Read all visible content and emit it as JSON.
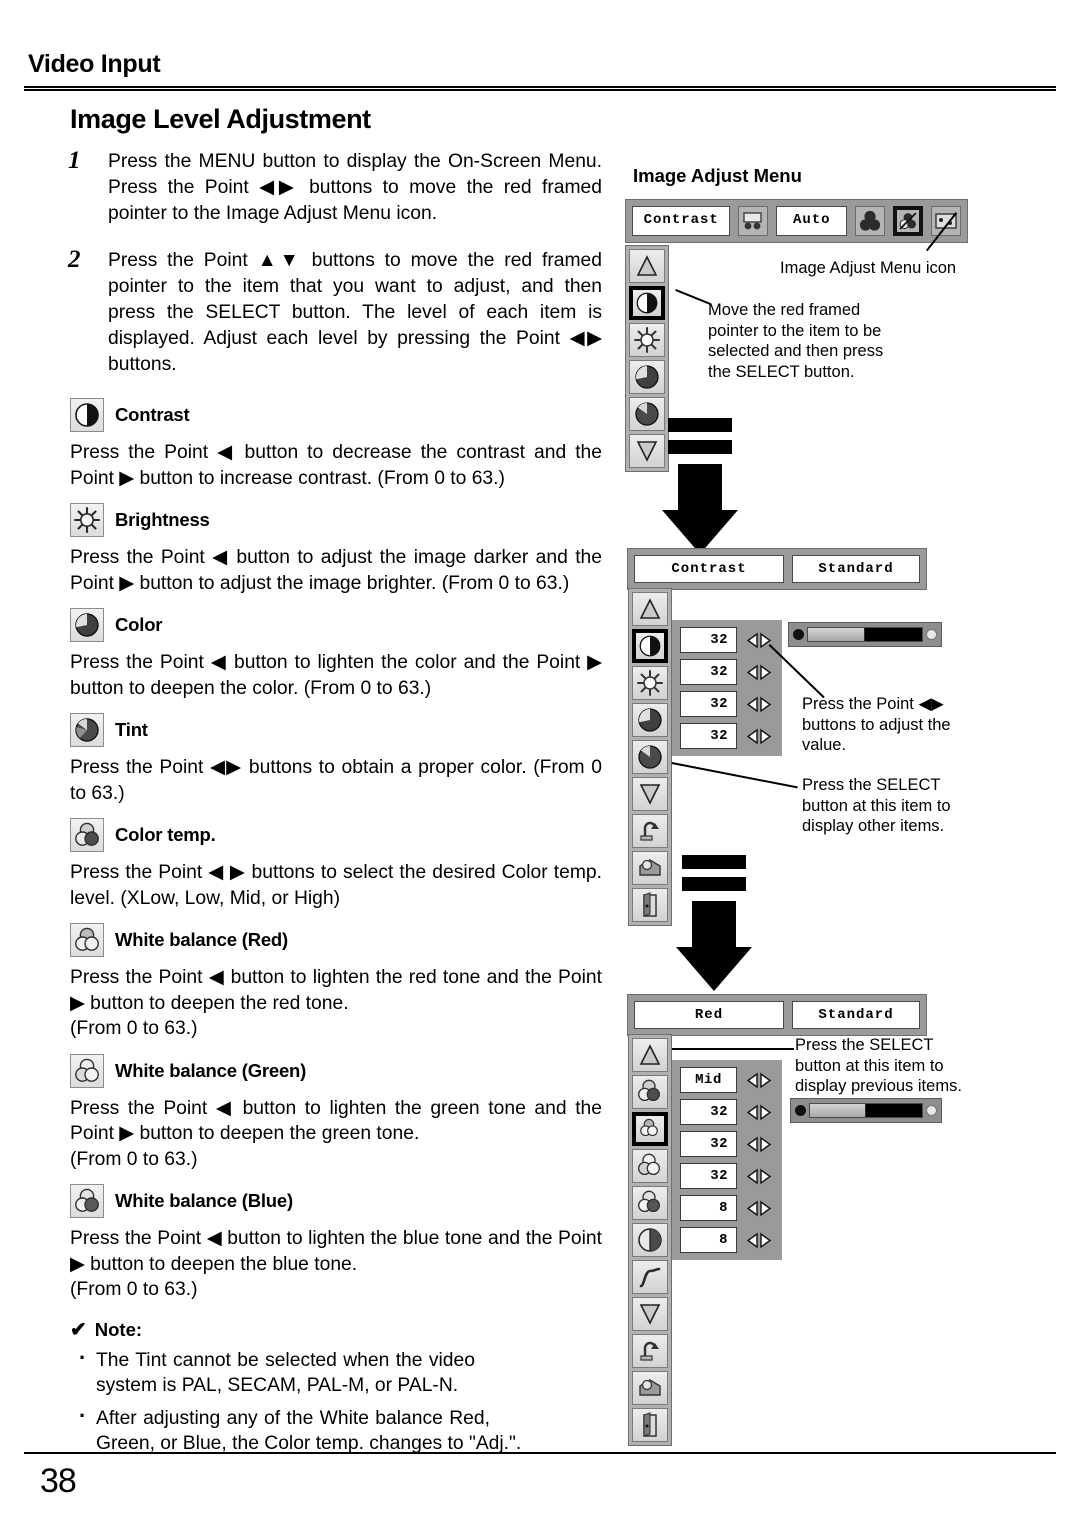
{
  "header": {
    "title": "Video Input"
  },
  "main": {
    "heading": "Image Level Adjustment",
    "steps": [
      {
        "num": "1",
        "text": "Press the MENU button to display the On-Screen Menu.  Press the Point ◀▶ buttons to move the red framed pointer to the Image Adjust Menu icon."
      },
      {
        "num": "2",
        "text": "Press the Point ▲▼ buttons to move the red framed pointer to the item that you want to adjust, and then press the SELECT button.  The level of each item is displayed.  Adjust each level by pressing the Point ◀▶ buttons."
      }
    ],
    "items": [
      {
        "icon": "contrast-icon",
        "title": "Contrast",
        "body": "Press the Point ◀ button to decrease the contrast and the Point ▶ button to increase contrast. (From 0 to 63.)"
      },
      {
        "icon": "brightness-icon",
        "title": "Brightness",
        "body": "Press the Point ◀ button to adjust the image darker and the Point ▶ button to adjust the image brighter. (From 0 to 63.)"
      },
      {
        "icon": "color-icon",
        "title": "Color",
        "body": "Press the Point ◀ button to lighten the color and the Point ▶ button to deepen the color. (From 0 to 63.)"
      },
      {
        "icon": "tint-icon",
        "title": "Tint",
        "body": "Press the Point ◀▶ buttons to obtain a proper color. (From 0 to 63.)"
      },
      {
        "icon": "color-temp-icon",
        "title": "Color temp.",
        "body": "Press the Point ◀ ▶ buttons to select the desired Color temp. level.  (XLow, Low, Mid, or High)"
      },
      {
        "icon": "white-balance-red-icon",
        "title": "White balance (Red)",
        "body": "Press the Point ◀ button to lighten the red tone and the Point ▶ button to deepen the red tone.\n(From 0 to 63.)"
      },
      {
        "icon": "white-balance-green-icon",
        "title": "White balance (Green)",
        "body": "Press the Point ◀ button to lighten the green tone and the Point ▶ button to deepen the green tone.\n(From 0 to 63.)"
      },
      {
        "icon": "white-balance-blue-icon",
        "title": "White balance (Blue)",
        "body": "Press the Point ◀ button to lighten the blue tone and the Point ▶ button to deepen the blue tone.\n(From 0 to 63.)"
      }
    ],
    "note": {
      "check": "✔",
      "label": "Note:",
      "bullets": [
        {
          "l1": "The Tint cannot be selected when the video",
          "l2": "system is PAL, SECAM, PAL-M, or PAL-N."
        },
        {
          "l1": "After adjusting any of the White balance Red,",
          "l2": "Green, or Blue, the Color temp. changes to \"Adj.\"."
        }
      ]
    }
  },
  "sidebar_figure": {
    "title": "Image Adjust Menu",
    "menubar": {
      "field_left": "Contrast",
      "field_right": "Auto",
      "icons": [
        "system-icon",
        "color-select-icon",
        "image-adjust-icon",
        "screen-icon"
      ],
      "selected_index": 2
    },
    "callouts": {
      "menu_icon": "Image Adjust Menu icon",
      "move_pointer": "Move the red framed\npointer to the item to be\nselected and then press\nthe SELECT button.",
      "adjust_value": "Press the Point ◀▶\nbuttons to adjust the\nvalue.",
      "select_other": "Press the SELECT\nbutton at this item to\ndisplay other items.",
      "select_previous": "Press the SELECT\nbutton at this item to\ndisplay previous items."
    },
    "panel_contrast": {
      "header_left": "Contrast",
      "header_right": "Standard",
      "side_icons": [
        "up-arrow-icon",
        "contrast-icon",
        "brightness-icon",
        "color-icon",
        "tint-icon",
        "down-arrow-icon",
        "reset-icon",
        "store-icon",
        "quit-icon"
      ],
      "selected_side_index": 1,
      "rows": [
        {
          "value": "32"
        },
        {
          "value": "32"
        },
        {
          "value": "32"
        },
        {
          "value": "32"
        }
      ],
      "slider_percent": 50
    },
    "panel_red": {
      "header_left": "Red",
      "header_right": "Standard",
      "side_icons": [
        "up-arrow-icon",
        "color-temp-icon",
        "white-balance-red-icon",
        "white-balance-green-icon",
        "white-balance-blue-icon",
        "sharpness-icon",
        "gamma-icon",
        "down-arrow-icon",
        "reset-icon",
        "store-icon",
        "quit-icon"
      ],
      "selected_side_index": 2,
      "rows": [
        {
          "value": "Mid",
          "centered": true
        },
        {
          "value": "32"
        },
        {
          "value": "32"
        },
        {
          "value": "32"
        },
        {
          "value": "8"
        },
        {
          "value": "8"
        }
      ],
      "slider_percent": 50
    }
  },
  "footer": {
    "page_number": "38"
  }
}
